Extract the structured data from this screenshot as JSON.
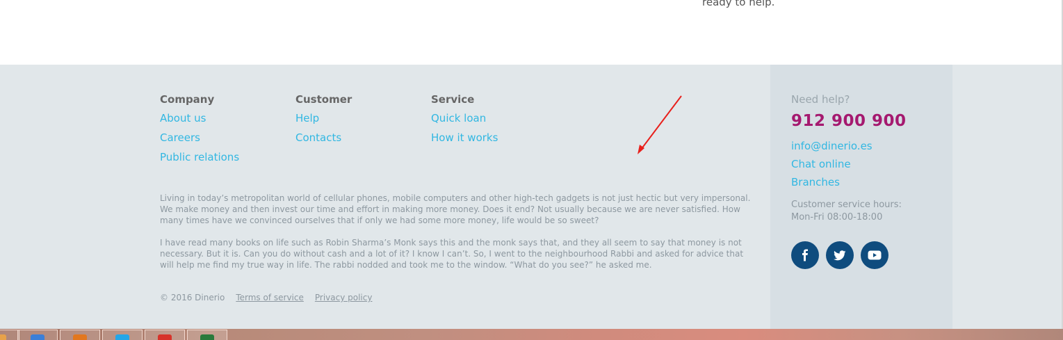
{
  "top_text": "ready to help.",
  "footer": {
    "columns": [
      {
        "title": "Company",
        "links": [
          "About us",
          "Careers",
          "Public relations"
        ]
      },
      {
        "title": "Customer",
        "links": [
          "Help",
          "Contacts"
        ]
      },
      {
        "title": "Service",
        "links": [
          "Quick loan",
          "How it works"
        ]
      }
    ],
    "paragraphs": [
      "Living in today’s metropolitan world of cellular phones, mobile computers and other high-tech gadgets is not just hectic but very impersonal. We make money and then invest our time and effort in making more money. Does it end? Not usually because we are never satisfied. How many times have we convinced ourselves that if only we had some more money, life would be so sweet?",
      "I have read many books on life such as Robin Sharma’s Monk says this and the monk says that, and they all seem to say that money is not necessary. But it is. Can you do without cash and a lot of it? I know I can’t. So, I went to the neighbourhood Rabbi and asked for advice that will help me find my true way in life. The rabbi nodded and took me to the window. “What do you see?” he asked me."
    ],
    "copyright": "© 2016 Dinerio",
    "terms": "Terms of service",
    "privacy": "Privacy policy"
  },
  "help": {
    "title": "Need help?",
    "phone": "912 900 900",
    "email": "info@dinerio.es",
    "chat": "Chat online",
    "branches": "Branches",
    "hours_label": "Customer service hours:",
    "hours_value": "Mon-Fri 08:00-18:00",
    "social": [
      "facebook-icon",
      "twitter-icon",
      "youtube-icon"
    ]
  },
  "colors": {
    "link": "#31b7e2",
    "phone": "#a5196f",
    "social_bg": "#0f4c7e",
    "annotation_arrow": "#e8201c"
  }
}
